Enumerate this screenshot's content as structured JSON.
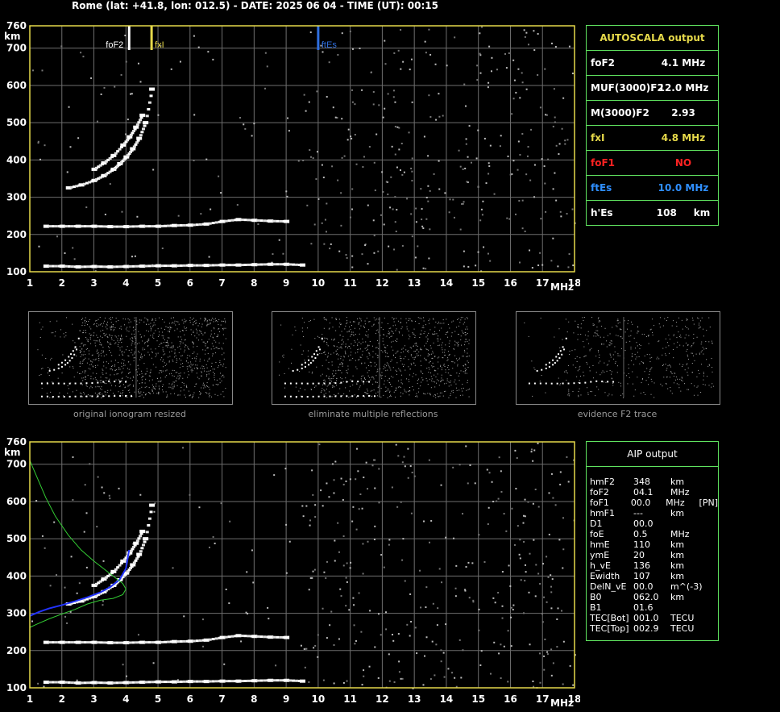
{
  "header": {
    "title": "Rome (lat: +41.8, lon: 012.5) - DATE: 2025 06 04 - TIME (UT): 00:15"
  },
  "colors": {
    "axis": "#e6d94a",
    "grid": "#6e6e6e",
    "table_border": "#5fe35f",
    "foF2_mark": "#ffffff",
    "fxI_mark": "#e6d94a",
    "ftEs_mark": "#2f6fe0",
    "profile_green": "#33cc33",
    "profile_blue": "#2233ff",
    "foF1": "#ff2222"
  },
  "autoscala": {
    "title": "AUTOSCALA output",
    "rows": [
      {
        "label": "foF2",
        "value": "4.1 MHz",
        "color": "#ffffff"
      },
      {
        "label": "MUF(3000)F2",
        "value": "12.0 MHz",
        "color": "#ffffff"
      },
      {
        "label": "M(3000)F2",
        "value": "2.93",
        "color": "#ffffff"
      },
      {
        "label": "fxI",
        "value": "4.8 MHz",
        "color": "#e6d94a"
      },
      {
        "label": "foF1",
        "value": "NO",
        "color": "#ff2222"
      },
      {
        "label": "ftEs",
        "value": "10.0 MHz",
        "color": "#2f8fff"
      },
      {
        "label": "h'Es",
        "value": "108     km",
        "color": "#ffffff"
      }
    ]
  },
  "thumbs": [
    {
      "caption": "original ionogram resized"
    },
    {
      "caption": "eliminate multiple reflections"
    },
    {
      "caption": "evidence F2 trace"
    }
  ],
  "aip": {
    "title": "AIP output",
    "lines": [
      [
        "hmF2",
        "348",
        "km",
        ""
      ],
      [
        "foF2",
        "04.1",
        "MHz",
        ""
      ],
      [
        "foF1",
        "00.0",
        "MHz",
        "[PN]"
      ],
      [
        "hmF1",
        "---",
        "km",
        ""
      ],
      [
        "D1",
        "00.0",
        "",
        ""
      ],
      [
        "foE",
        "0.5",
        "MHz",
        ""
      ],
      [
        "hmE",
        "110",
        "km",
        ""
      ],
      [
        "ymE",
        "20",
        "km",
        ""
      ],
      [
        "h_vE",
        "136",
        "km",
        ""
      ],
      [
        "Ewidth",
        "107",
        "km",
        ""
      ],
      [
        "DelN_vE",
        "00.0",
        "m^(-3)",
        ""
      ],
      [
        "B0",
        "062.0",
        "km",
        ""
      ],
      [
        "B1",
        "01.6",
        "",
        ""
      ],
      [
        "TEC[Bot]",
        "001.0",
        "TECU",
        ""
      ],
      [
        "TEC[Top]",
        "002.9",
        "TECU",
        ""
      ]
    ]
  },
  "chart_data": [
    {
      "type": "scatter",
      "title": "",
      "xlabel": "MHz",
      "ylabel": "km",
      "xlim": [
        1,
        18
      ],
      "ylim": [
        100,
        760
      ],
      "x_ticks": [
        1,
        2,
        3,
        4,
        5,
        6,
        7,
        8,
        9,
        10,
        11,
        12,
        13,
        14,
        15,
        16,
        17,
        18
      ],
      "y_ticks": [
        100,
        200,
        300,
        400,
        500,
        600,
        700,
        760
      ],
      "grid": true,
      "markers": [
        {
          "name": "foF2",
          "x": 4.1
        },
        {
          "name": "fxI",
          "x": 4.8
        },
        {
          "name": "ftEs",
          "x": 10.0
        }
      ],
      "series": [
        {
          "x": [
            1.5,
            2,
            2.5,
            3,
            3.5,
            4,
            4.5,
            5,
            5.5,
            6,
            6.5,
            7,
            7.5,
            8,
            8.5,
            9,
            9.5
          ],
          "y": [
            115,
            115,
            113,
            114,
            113,
            114,
            115,
            116,
            116,
            117,
            117,
            118,
            118,
            119,
            120,
            120,
            118
          ]
        },
        {
          "x": [
            1.5,
            2,
            2.5,
            3,
            3.5,
            4,
            4.5,
            5,
            5.5,
            6,
            6.5,
            7,
            7.5,
            8,
            8.5,
            9
          ],
          "y": [
            222,
            222,
            222,
            222,
            221,
            221,
            222,
            222,
            224,
            225,
            228,
            235,
            240,
            238,
            236,
            235
          ]
        },
        {
          "x": [
            2.2,
            2.6,
            3,
            3.3,
            3.6,
            3.8,
            4,
            4.2,
            4.4,
            4.6,
            4.8
          ],
          "y": [
            325,
            333,
            345,
            358,
            375,
            390,
            408,
            430,
            458,
            500,
            590
          ]
        },
        {
          "x": [
            3,
            3.3,
            3.6,
            3.9,
            4.1,
            4.3,
            4.5
          ],
          "y": [
            375,
            392,
            412,
            440,
            462,
            488,
            520
          ]
        }
      ]
    },
    {
      "type": "scatter",
      "title": "",
      "xlabel": "MHz",
      "ylabel": "km",
      "xlim": [
        1,
        18
      ],
      "ylim": [
        100,
        760
      ],
      "x_ticks": [
        1,
        2,
        3,
        4,
        5,
        6,
        7,
        8,
        9,
        10,
        11,
        12,
        13,
        14,
        15,
        16,
        17,
        18
      ],
      "y_ticks": [
        100,
        200,
        300,
        400,
        500,
        600,
        700,
        760
      ],
      "grid": true,
      "series": [
        {
          "x": [
            1.5,
            2,
            2.5,
            3,
            3.5,
            4,
            4.5,
            5,
            5.5,
            6,
            6.5,
            7,
            7.5,
            8,
            8.5,
            9,
            9.5
          ],
          "y": [
            115,
            115,
            113,
            114,
            113,
            114,
            115,
            116,
            116,
            117,
            117,
            118,
            118,
            119,
            120,
            120,
            118
          ]
        },
        {
          "x": [
            1.5,
            2,
            2.5,
            3,
            3.5,
            4,
            4.5,
            5,
            5.5,
            6,
            6.5,
            7,
            7.5,
            8,
            8.5,
            9
          ],
          "y": [
            222,
            222,
            222,
            222,
            221,
            221,
            222,
            222,
            224,
            225,
            228,
            235,
            240,
            238,
            236,
            235
          ]
        },
        {
          "x": [
            2.2,
            2.6,
            3,
            3.3,
            3.6,
            3.8,
            4,
            4.2,
            4.4,
            4.6,
            4.8
          ],
          "y": [
            325,
            333,
            345,
            358,
            375,
            390,
            408,
            430,
            458,
            500,
            590
          ]
        },
        {
          "x": [
            3,
            3.3,
            3.6,
            3.9,
            4.1,
            4.3,
            4.5
          ],
          "y": [
            375,
            392,
            412,
            440,
            462,
            488,
            520
          ]
        },
        {
          "x": [
            1,
            1.3,
            1.6,
            2,
            2.4,
            2.8,
            3.2,
            3.5,
            3.8,
            4,
            4.1
          ],
          "y": [
            293,
            304,
            313,
            322,
            332,
            343,
            356,
            370,
            390,
            420,
            470
          ]
        },
        {
          "x": [
            1,
            1.2,
            1.5,
            1.8,
            2.2,
            2.6,
            3,
            3.3,
            3.6,
            3.9,
            4.0,
            3.9,
            3.6,
            3.2,
            2.8,
            2.4,
            2,
            1.6,
            1.2,
            1
          ],
          "y": [
            710,
            670,
            610,
            560,
            510,
            470,
            440,
            420,
            400,
            380,
            365,
            350,
            340,
            335,
            325,
            310,
            298,
            285,
            270,
            262
          ]
        }
      ]
    }
  ]
}
